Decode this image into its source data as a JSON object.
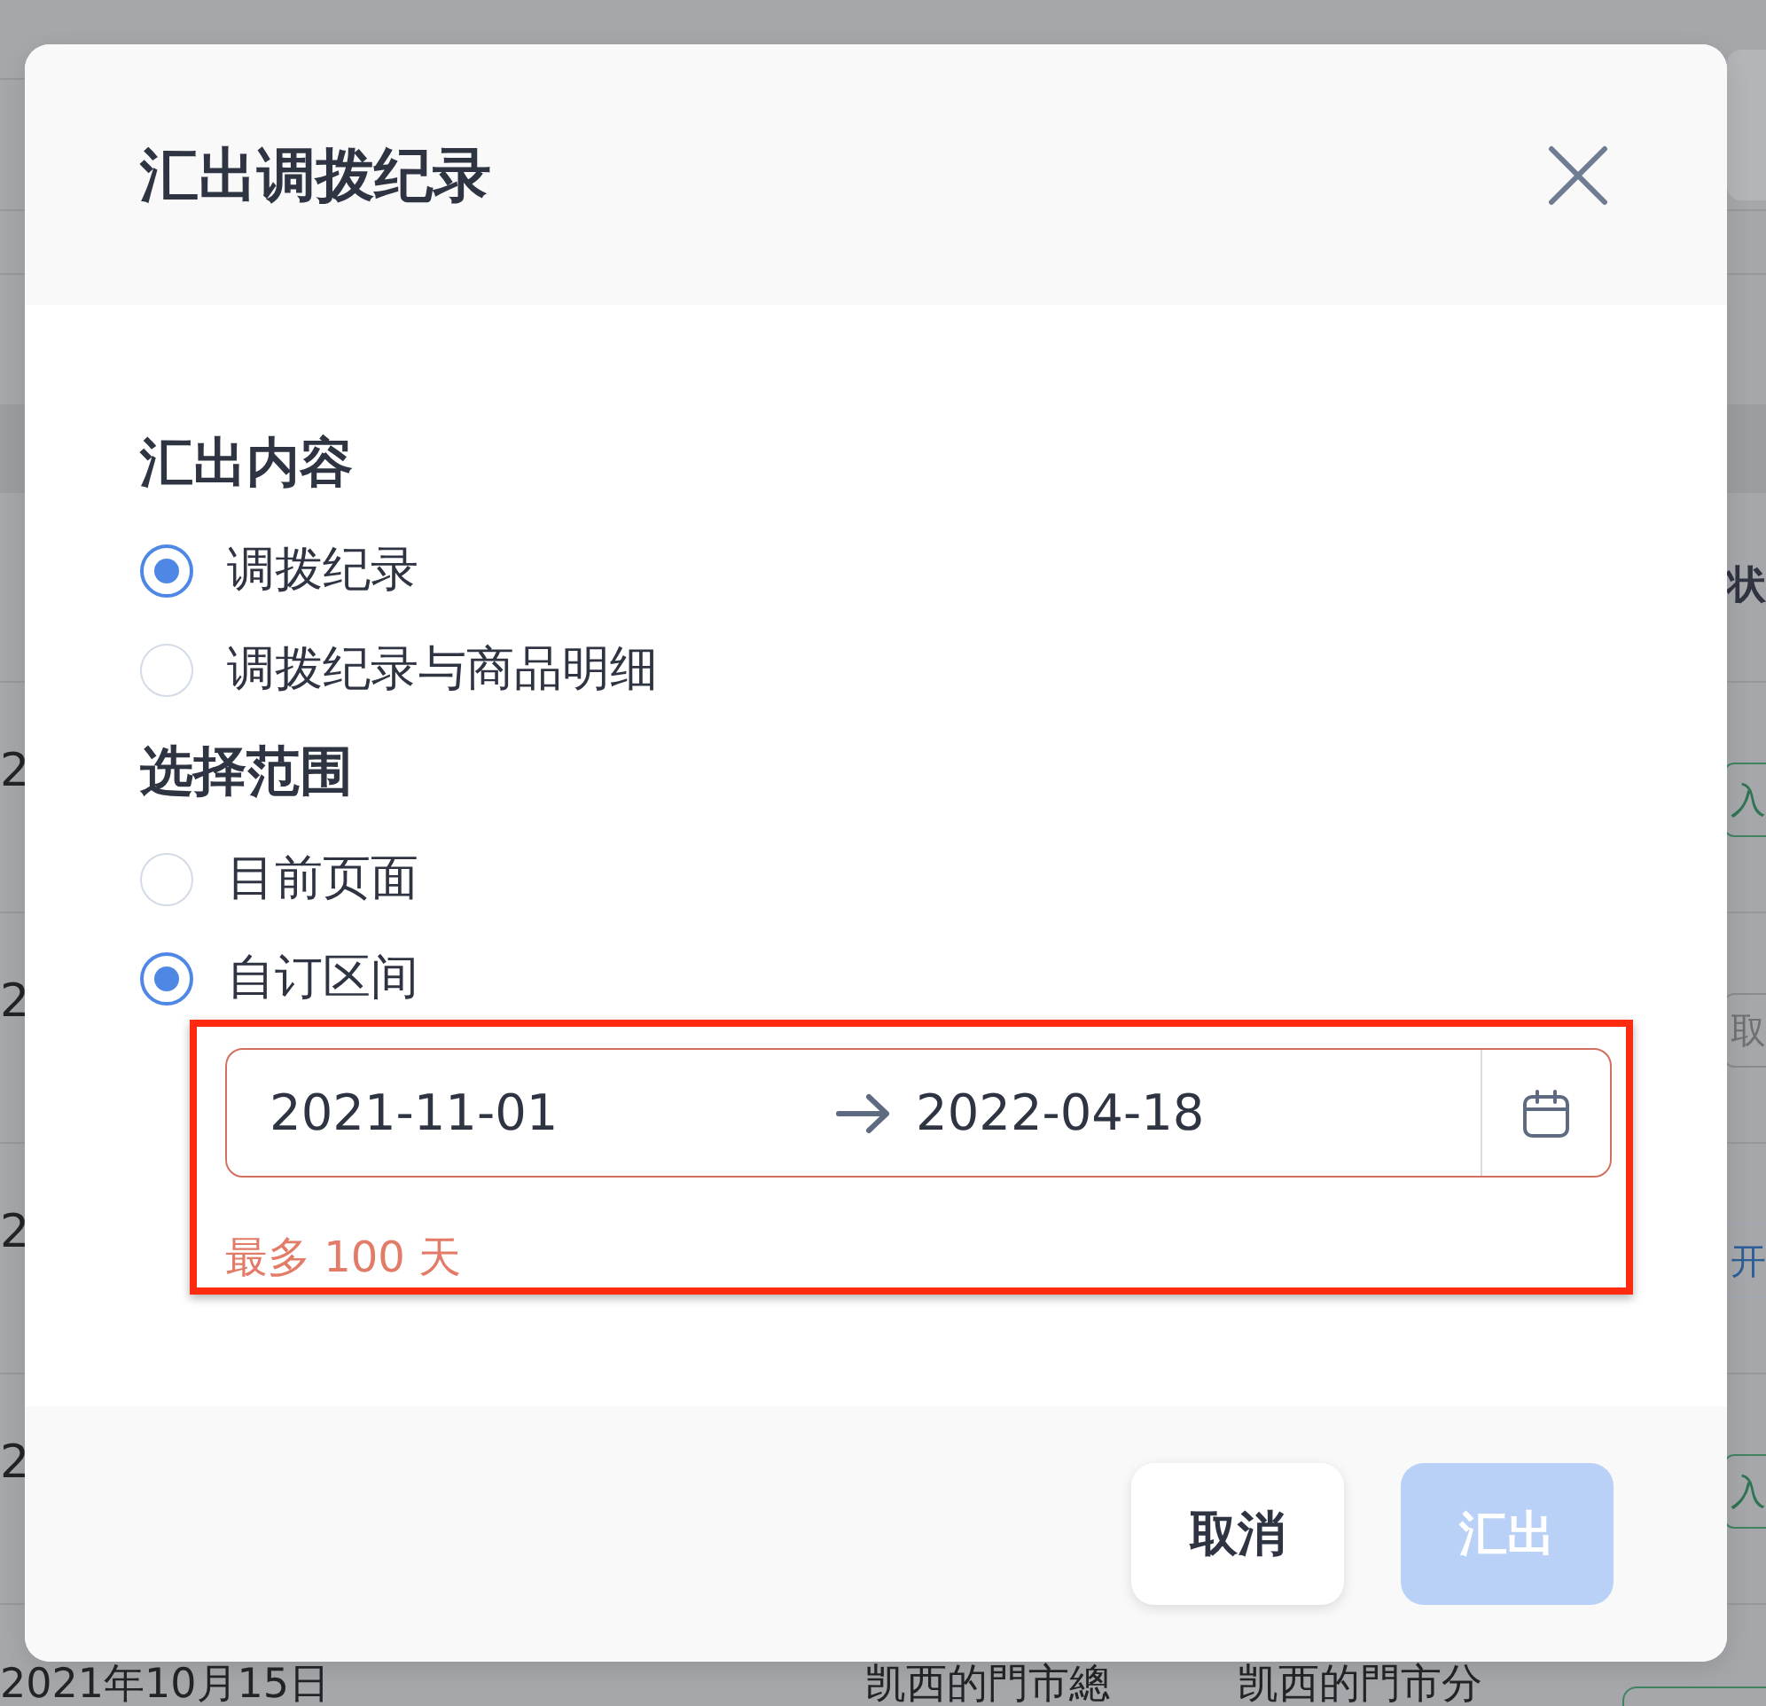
{
  "background_page": {
    "status_header": "状",
    "rows": [
      {
        "column_1": "2",
        "status": {
          "label": "入",
          "kind": "success"
        }
      },
      {
        "column_1": "2",
        "status": {
          "label": "取",
          "kind": "cancelled"
        }
      },
      {
        "column_1": "2",
        "status": {
          "label": "开",
          "kind": "active"
        }
      },
      {
        "column_1": "2",
        "status": {
          "label": "入",
          "kind": "success"
        }
      }
    ],
    "last_row": {
      "column_1": "2021年10月15日",
      "column_3": "凯西的門市總",
      "column_4": "凯西的門市分",
      "status": {
        "kind": "success"
      }
    }
  },
  "dialog": {
    "title": "汇出调拨纪录",
    "sections": [
      {
        "title": "汇出内容",
        "options": [
          {
            "label": "调拨纪录",
            "selected": true
          },
          {
            "label": "调拨纪录与商品明细",
            "selected": false
          }
        ]
      },
      {
        "title": "选择范围",
        "options": [
          {
            "label": "目前页面",
            "selected": false
          },
          {
            "label": "自订区间",
            "selected": true
          }
        ]
      }
    ],
    "date_range": {
      "start": "2021-11-01",
      "end": "2022-04-18",
      "error": true,
      "highlighted": true,
      "hint": "最多 100 天"
    },
    "buttons": [
      {
        "label": "取消",
        "kind": "secondary",
        "disabled": false
      },
      {
        "label": "汇出",
        "kind": "primary",
        "disabled": true
      }
    ]
  }
}
